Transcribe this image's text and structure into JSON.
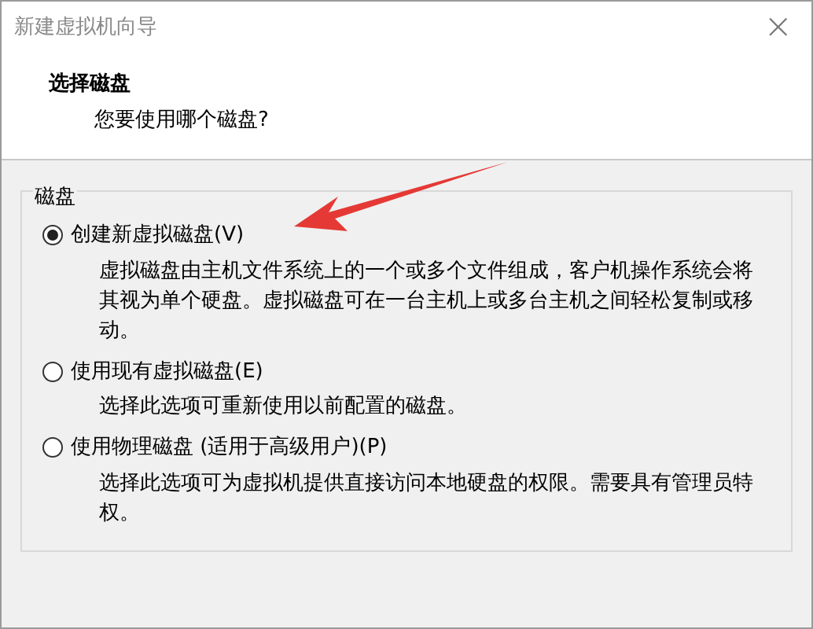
{
  "window": {
    "title": "新建虚拟机向导",
    "close": "×"
  },
  "header": {
    "title": "选择磁盘",
    "subtitle": "您要使用哪个磁盘?"
  },
  "group": {
    "label": "磁盘",
    "options": [
      {
        "label": "创建新虚拟磁盘(V)",
        "selected": true,
        "description": "虚拟磁盘由主机文件系统上的一个或多个文件组成，客户机操作系统会将其视为单个硬盘。虚拟磁盘可在一台主机上或多台主机之间轻松复制或移动。"
      },
      {
        "label": "使用现有虚拟磁盘(E)",
        "selected": false,
        "description": "选择此选项可重新使用以前配置的磁盘。"
      },
      {
        "label": "使用物理磁盘 (适用于高级用户)(P)",
        "selected": false,
        "description": "选择此选项可为虚拟机提供直接访问本地硬盘的权限。需要具有管理员特权。"
      }
    ]
  }
}
